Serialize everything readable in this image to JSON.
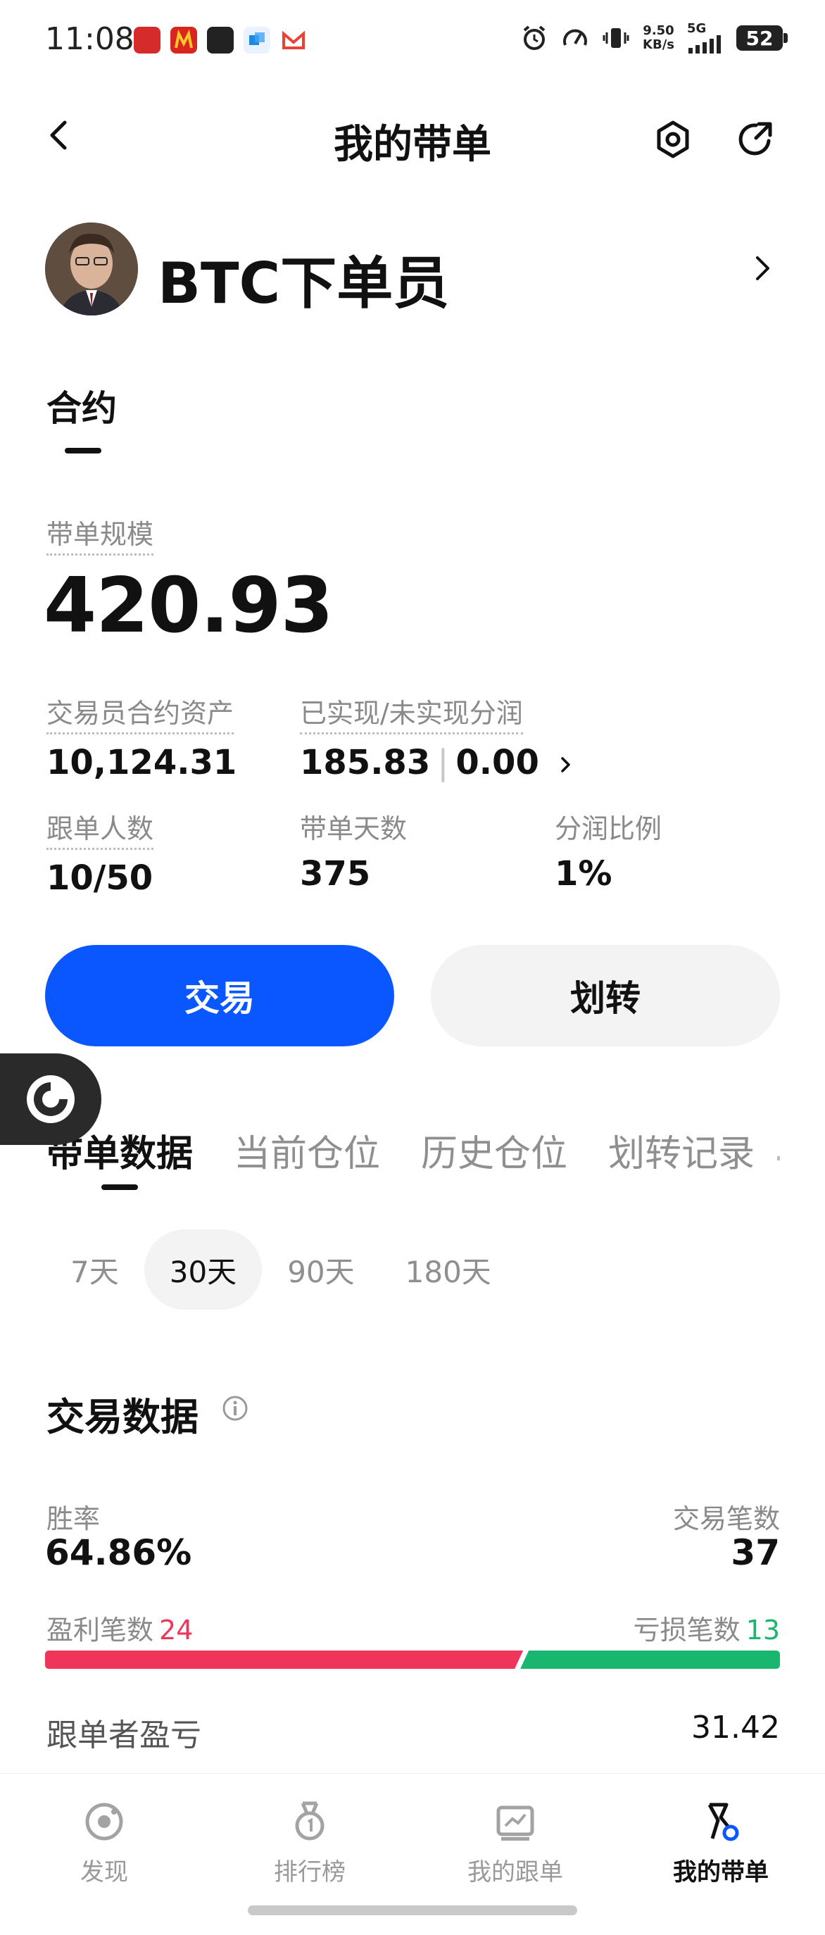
{
  "status_bar": {
    "time": "11:08",
    "net_speed_value": "9.50",
    "net_speed_unit": "KB/s",
    "network": "5G",
    "battery": "52"
  },
  "header": {
    "title": "我的带单"
  },
  "profile": {
    "name": "BTC下单员"
  },
  "contract_tab": "合约",
  "scale": {
    "label": "带单规模",
    "value": "420.93"
  },
  "stats": {
    "assets_label": "交易员合约资产",
    "assets_value": "10,124.31",
    "profit_label": "已实现/未实现分润",
    "realized": "185.83",
    "unrealized": "0.00",
    "followers_label": "跟单人数",
    "followers_value": "10/50",
    "days_label": "带单天数",
    "days_value": "375",
    "share_label": "分润比例",
    "share_value": "1%"
  },
  "buttons": {
    "trade": "交易",
    "transfer": "划转"
  },
  "data_tabs": [
    "带单数据",
    "当前仓位",
    "历史仓位",
    "划转记录"
  ],
  "periods": [
    "7天",
    "30天",
    "90天",
    "180天"
  ],
  "trade_data": {
    "title": "交易数据",
    "win_rate_label": "胜率",
    "win_rate": "64.86%",
    "trade_count_label": "交易笔数",
    "trade_count": "37",
    "profit_trades_label": "盈利笔数",
    "profit_trades": "24",
    "loss_trades_label": "亏损笔数",
    "loss_trades": "13",
    "win_fraction": 0.6486,
    "follower_pnl_label": "跟单者盈亏",
    "follower_pnl": "31.42"
  },
  "colors": {
    "primary": "#0a57ff",
    "profit": "#f0355b",
    "loss": "#19b66f"
  },
  "bottom_nav": [
    {
      "label": "发现",
      "icon": "discover-icon"
    },
    {
      "label": "排行榜",
      "icon": "ranking-medal-icon"
    },
    {
      "label": "我的跟单",
      "icon": "my-follow-chart-icon"
    },
    {
      "label": "我的带单",
      "icon": "my-lead-flag-icon"
    }
  ]
}
